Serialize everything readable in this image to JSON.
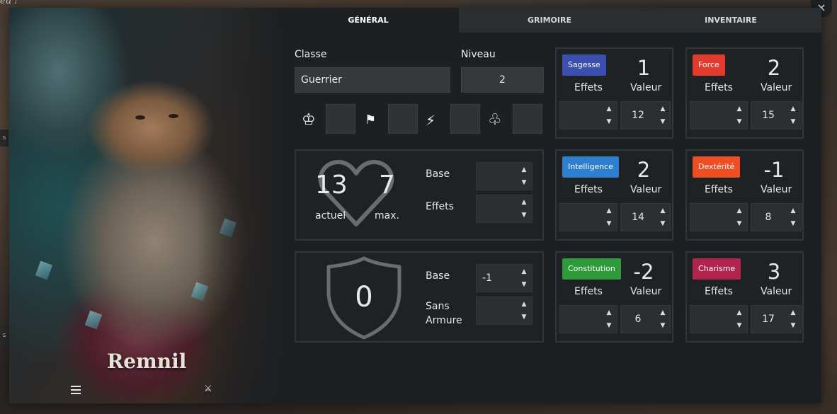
{
  "backdrop": {
    "text": "eu !",
    "left_tab_1": "s",
    "left_tab_2": "s"
  },
  "close_label": "×",
  "character": {
    "name": "Remnil"
  },
  "tabs": [
    {
      "label": "Général",
      "active": true
    },
    {
      "label": "Grimoire",
      "active": false
    },
    {
      "label": "Inventaire",
      "active": false
    }
  ],
  "general": {
    "class_label": "Classe",
    "class_value": "Guerrier",
    "level_label": "Niveau",
    "level_value": "2",
    "icons": [
      "crown-icon",
      "flag-icon",
      "running-icon",
      "clover-icon"
    ],
    "hp": {
      "current": "13",
      "max": "7",
      "current_label": "actuel",
      "max_label": "max.",
      "base_label": "Base",
      "base_value": "",
      "effects_label": "Effets",
      "effects_value": ""
    },
    "armor": {
      "value": "0",
      "base_label": "Base",
      "base_value": "-1",
      "unarmored_label": "Sans Armure",
      "unarmored_value": ""
    }
  },
  "labels": {
    "effects": "Effets",
    "value": "Valeur"
  },
  "stats": [
    {
      "name": "Sagesse",
      "color": "#3b4fb0",
      "mod": "1",
      "value": "12"
    },
    {
      "name": "Force",
      "color": "#e23a2c",
      "mod": "2",
      "value": "15"
    },
    {
      "name": "Intelligence",
      "color": "#2f7fd0",
      "mod": "2",
      "value": "14"
    },
    {
      "name": "Dextérité",
      "color": "#ee4e21",
      "mod": "-1",
      "value": "8"
    },
    {
      "name": "Constitution",
      "color": "#2f9a3a",
      "mod": "-2",
      "value": "6"
    },
    {
      "name": "Charisme",
      "color": "#b0244e",
      "mod": "3",
      "value": "17"
    }
  ]
}
